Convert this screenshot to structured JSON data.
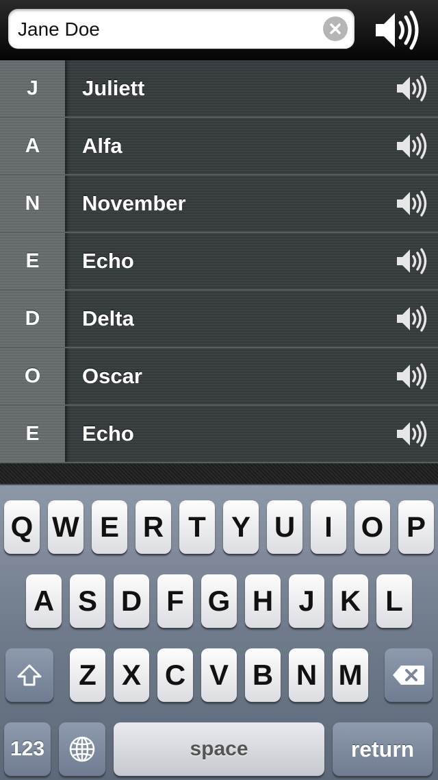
{
  "search": {
    "value": "Jane Doe"
  },
  "rows": [
    {
      "letter": "J",
      "word": "Juliett"
    },
    {
      "letter": "A",
      "word": "Alfa"
    },
    {
      "letter": "N",
      "word": "November"
    },
    {
      "letter": "E",
      "word": "Echo"
    },
    {
      "letter": "D",
      "word": "Delta"
    },
    {
      "letter": "O",
      "word": "Oscar"
    },
    {
      "letter": "E",
      "word": "Echo"
    }
  ],
  "keyboard": {
    "row1": [
      "Q",
      "W",
      "E",
      "R",
      "T",
      "Y",
      "U",
      "I",
      "O",
      "P"
    ],
    "row2": [
      "A",
      "S",
      "D",
      "F",
      "G",
      "H",
      "J",
      "K",
      "L"
    ],
    "row3": [
      "Z",
      "X",
      "C",
      "V",
      "B",
      "N",
      "M"
    ],
    "numbers_label": "123",
    "space_label": "space",
    "return_label": "return"
  },
  "icons": {
    "speaker": "speaker-icon",
    "clear": "clear-icon",
    "shift": "shift-icon",
    "delete": "delete-icon",
    "globe": "globe-icon"
  }
}
